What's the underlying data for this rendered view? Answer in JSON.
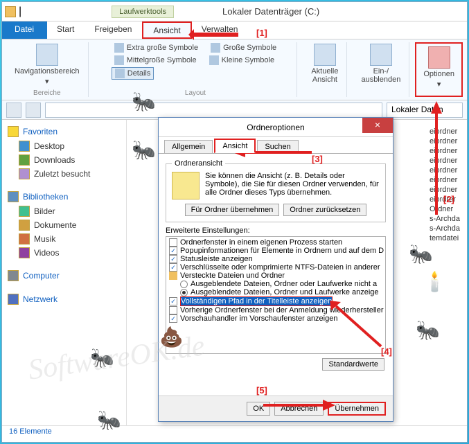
{
  "titlebar": {
    "tooltab": "Laufwerktools",
    "title": "Lokaler Datenträger (C:)"
  },
  "ribbon_tabs": {
    "file": "Datei",
    "start": "Start",
    "share": "Freigeben",
    "view": "Ansicht",
    "manage": "Verwalten"
  },
  "ribbon": {
    "navpane": "Navigationsbereich",
    "areas_label": "Bereiche",
    "layout": {
      "xlarge": "Extra große Symbole",
      "large": "Große Symbole",
      "medium": "Mittelgroße Symbole",
      "small": "Kleine Symbole",
      "details": "Details",
      "group_label": "Layout"
    },
    "current_view": "Aktuelle\nAnsicht",
    "hide": "Ein-/\nausblenden",
    "options": "Optionen"
  },
  "addrbar": {
    "path": "Lokaler Daten"
  },
  "sidebar": {
    "favorites": "Favoriten",
    "desktop": "Desktop",
    "downloads": "Downloads",
    "recent": "Zuletzt besucht",
    "libraries": "Bibliotheken",
    "pictures": "Bilder",
    "documents": "Dokumente",
    "music": "Musik",
    "videos": "Videos",
    "computer": "Computer",
    "network": "Netzwerk"
  },
  "filepane": {
    "items": [
      "eiordner",
      "eiordner",
      "eiordner",
      "eiordner",
      "eiordner",
      "eiordner",
      "eiordner",
      "eiordrer",
      "Ordner",
      "s-Archda",
      "s-Archda",
      "temdatei"
    ]
  },
  "statusbar": {
    "count": "16 Elemente"
  },
  "dialog": {
    "title": "Ordneroptionen",
    "tabs": {
      "general": "Allgemein",
      "view": "Ansicht",
      "search": "Suchen"
    },
    "folderview": {
      "legend": "Ordneransicht",
      "desc": "Sie können die Ansicht (z. B. Details oder Symbole), die Sie für diesen Ordner verwenden, für alle Ordner dieses Typs übernehmen.",
      "apply_folders": "Für Ordner übernehmen",
      "reset_folders": "Ordner zurücksetzen"
    },
    "advanced_label": "Erweiterte Einstellungen:",
    "settings": {
      "s1": "Ordnerfenster in einem eigenen Prozess starten",
      "s2": "Popupinformationen für Elemente in Ordnern und auf dem D",
      "s3": "Statusleiste anzeigen",
      "s4": "Verschlüsselte oder komprimierte NTFS-Dateien in anderer",
      "s5": "Versteckte Dateien und Ordner",
      "s6": "Ausgeblendete Dateien, Ordner oder Laufwerke nicht a",
      "s7": "Ausgeblendete Dateien, Ordner und Laufwerke anzeige",
      "s8": "Vollständigen Pfad in der Titelleiste anzeigen",
      "s9": "Vorherige Ordnerfenster bei der Anmeldung wiederhersteller",
      "s10": "Vorschauhandler im Vorschaufenster anzeigen"
    },
    "defaults": "Standardwerte",
    "ok": "OK",
    "cancel": "Abbrechen",
    "apply": "Übernehmen"
  },
  "markers": {
    "m1": "[1]",
    "m2": "[2]",
    "m3": "[3]",
    "m4": "[4]",
    "m5": "[5]"
  },
  "watermark": "SoftwareOK.de"
}
